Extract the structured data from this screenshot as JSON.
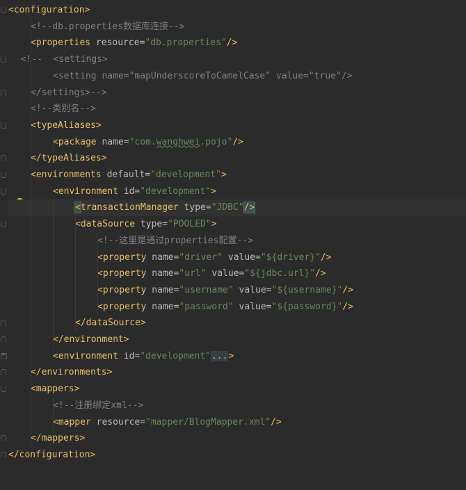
{
  "editor": {
    "language": "xml",
    "lines": [
      {
        "indent": 0,
        "parts": [
          {
            "t": "tag",
            "s": "<configuration>"
          }
        ]
      },
      {
        "indent": 1,
        "parts": [
          {
            "t": "cmt",
            "s": "<!--db.properties数据库连接-->"
          }
        ]
      },
      {
        "indent": 1,
        "parts": [
          {
            "t": "tag",
            "s": "<properties "
          },
          {
            "t": "attr",
            "s": "resource="
          },
          {
            "t": "val",
            "s": "\"db.properties\""
          },
          {
            "t": "tag",
            "s": "/>"
          }
        ]
      },
      {
        "indent": 0.55,
        "parts": [
          {
            "t": "cmt",
            "s": "<!--  <settings>"
          }
        ]
      },
      {
        "indent": 2,
        "parts": [
          {
            "t": "cmt",
            "s": "<setting name=\"mapUnderscoreToCamelCase\" value=\"true\"/>"
          }
        ]
      },
      {
        "indent": 1,
        "parts": [
          {
            "t": "cmt",
            "s": "</settings>-->"
          }
        ]
      },
      {
        "indent": 1,
        "parts": [
          {
            "t": "cmt",
            "s": "<!--类别名-->"
          }
        ]
      },
      {
        "indent": 1,
        "parts": [
          {
            "t": "tag",
            "s": "<typeAliases>"
          }
        ]
      },
      {
        "indent": 2,
        "parts": [
          {
            "t": "tag",
            "s": "<package "
          },
          {
            "t": "attr",
            "s": "name="
          },
          {
            "t": "val",
            "s": "\"com."
          },
          {
            "t": "valtypo",
            "s": "wanghwei"
          },
          {
            "t": "val",
            "s": ".pojo\""
          },
          {
            "t": "tag",
            "s": "/>"
          }
        ]
      },
      {
        "indent": 1,
        "parts": [
          {
            "t": "tag",
            "s": "</typeAliases>"
          }
        ]
      },
      {
        "indent": 1,
        "parts": [
          {
            "t": "tag",
            "s": "<environments "
          },
          {
            "t": "attr",
            "s": "default="
          },
          {
            "t": "val",
            "s": "\"development\""
          },
          {
            "t": "tag",
            "s": ">"
          }
        ]
      },
      {
        "indent": 2,
        "parts": [
          {
            "t": "tag",
            "s": "<environment "
          },
          {
            "t": "attr",
            "s": "id="
          },
          {
            "t": "val",
            "s": "\"development\""
          },
          {
            "t": "tag",
            "s": ">"
          }
        ]
      },
      {
        "indent": 3,
        "current": true,
        "parts": [
          {
            "t": "taghl",
            "s": "<"
          },
          {
            "t": "tag",
            "s": "transactionManager "
          },
          {
            "t": "attr",
            "s": "type="
          },
          {
            "t": "val",
            "s": "\"JDBC\""
          },
          {
            "t": "taghl",
            "s": "/>"
          },
          {
            "t": "caret",
            "s": ""
          }
        ]
      },
      {
        "indent": 3,
        "parts": [
          {
            "t": "tag",
            "s": "<dataSource "
          },
          {
            "t": "attr",
            "s": "type="
          },
          {
            "t": "val",
            "s": "\"POOLED\""
          },
          {
            "t": "tag",
            "s": ">"
          }
        ]
      },
      {
        "indent": 4,
        "parts": [
          {
            "t": "cmt",
            "s": "<!--这里是通过properties配置-->"
          }
        ]
      },
      {
        "indent": 4,
        "parts": [
          {
            "t": "tag",
            "s": "<property "
          },
          {
            "t": "attr",
            "s": "name="
          },
          {
            "t": "val",
            "s": "\"driver\""
          },
          {
            "t": "attr",
            "s": " value="
          },
          {
            "t": "val",
            "s": "\"${driver}\""
          },
          {
            "t": "tag",
            "s": "/>"
          }
        ]
      },
      {
        "indent": 4,
        "parts": [
          {
            "t": "tag",
            "s": "<property "
          },
          {
            "t": "attr",
            "s": "name="
          },
          {
            "t": "val",
            "s": "\"url\""
          },
          {
            "t": "attr",
            "s": " value="
          },
          {
            "t": "val",
            "s": "\"${jdbc.url}\""
          },
          {
            "t": "tag",
            "s": "/>"
          }
        ]
      },
      {
        "indent": 4,
        "parts": [
          {
            "t": "tag",
            "s": "<property "
          },
          {
            "t": "attr",
            "s": "name="
          },
          {
            "t": "val",
            "s": "\"username\""
          },
          {
            "t": "attr",
            "s": " value="
          },
          {
            "t": "val",
            "s": "\"${username}\""
          },
          {
            "t": "tag",
            "s": "/>"
          }
        ]
      },
      {
        "indent": 4,
        "parts": [
          {
            "t": "tag",
            "s": "<property "
          },
          {
            "t": "attr",
            "s": "name="
          },
          {
            "t": "val",
            "s": "\"password\""
          },
          {
            "t": "attr",
            "s": " value="
          },
          {
            "t": "val",
            "s": "\"${password}\""
          },
          {
            "t": "tag",
            "s": "/>"
          }
        ]
      },
      {
        "indent": 3,
        "parts": [
          {
            "t": "tag",
            "s": "</dataSource>"
          }
        ]
      },
      {
        "indent": 2,
        "parts": [
          {
            "t": "tag",
            "s": "</environment>"
          }
        ]
      },
      {
        "indent": 2,
        "parts": [
          {
            "t": "tag",
            "s": "<environment "
          },
          {
            "t": "attr",
            "s": "id="
          },
          {
            "t": "val",
            "s": "\"development\""
          },
          {
            "t": "dots",
            "s": "..."
          },
          {
            "t": "tag",
            "s": ">"
          }
        ]
      },
      {
        "indent": 1,
        "parts": [
          {
            "t": "tag",
            "s": "</environments>"
          }
        ]
      },
      {
        "indent": 1,
        "parts": [
          {
            "t": "tag",
            "s": "<mappers>"
          }
        ]
      },
      {
        "indent": 2,
        "parts": [
          {
            "t": "cmt",
            "s": "<!--注册绑定xml-->"
          }
        ]
      },
      {
        "indent": 2,
        "parts": [
          {
            "t": "tag",
            "s": "<mapper "
          },
          {
            "t": "attr",
            "s": "resource="
          },
          {
            "t": "val",
            "s": "\"mapper/BlogMapper.xml\""
          },
          {
            "t": "tag",
            "s": "/>"
          }
        ]
      },
      {
        "indent": 1,
        "parts": [
          {
            "t": "tag",
            "s": "</mappers>"
          }
        ]
      },
      {
        "indent": 0,
        "parts": [
          {
            "t": "tag",
            "s": "</configuration>"
          }
        ]
      }
    ]
  },
  "gutter": {
    "intention_icon": "lightbulb-icon"
  }
}
